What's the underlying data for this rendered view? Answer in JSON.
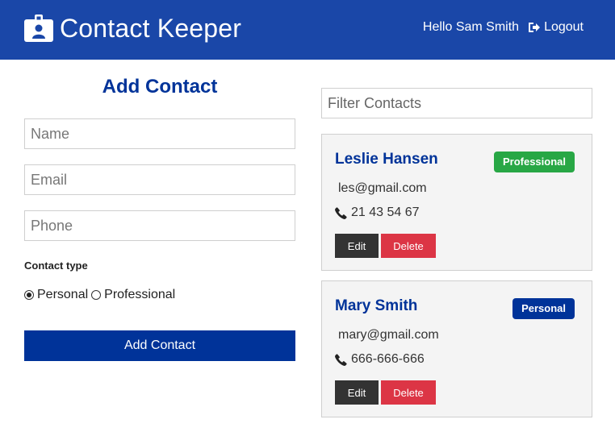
{
  "navbar": {
    "brand": "Contact Keeper",
    "logo_icon": "id-badge-icon",
    "greeting": "Hello Sam Smith",
    "logout_label": "Logout",
    "logout_icon": "sign-out-icon",
    "background": "#1a47a8"
  },
  "form": {
    "title": "Add Contact",
    "name_placeholder": "Name",
    "email_placeholder": "Email",
    "phone_placeholder": "Phone",
    "contact_type_label": "Contact type",
    "options": [
      {
        "label": "Personal",
        "checked": true
      },
      {
        "label": "Professional",
        "checked": false
      }
    ],
    "submit_label": "Add Contact",
    "accent": "#003399"
  },
  "filter": {
    "placeholder": "Filter Contacts"
  },
  "contacts": [
    {
      "name": "Leslie Hansen",
      "type": "Professional",
      "email": "les@gmail.com",
      "phone": "21 43 54 67",
      "edit_label": "Edit",
      "delete_label": "Delete"
    },
    {
      "name": "Mary Smith",
      "type": "Personal",
      "email": "mary@gmail.com",
      "phone": "666-666-666",
      "edit_label": "Edit",
      "delete_label": "Delete"
    }
  ],
  "colors": {
    "professional_badge": "#28a745",
    "personal_badge": "#003399",
    "delete": "#dc3545",
    "edit": "#333333"
  }
}
